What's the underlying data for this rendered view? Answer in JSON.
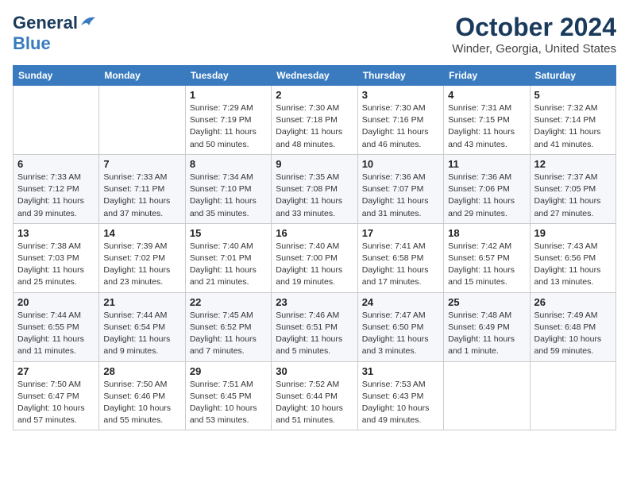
{
  "logo": {
    "line1": "General",
    "line2": "Blue"
  },
  "title": "October 2024",
  "subtitle": "Winder, Georgia, United States",
  "days_of_week": [
    "Sunday",
    "Monday",
    "Tuesday",
    "Wednesday",
    "Thursday",
    "Friday",
    "Saturday"
  ],
  "weeks": [
    [
      {
        "day": "",
        "info": ""
      },
      {
        "day": "",
        "info": ""
      },
      {
        "day": "1",
        "info": "Sunrise: 7:29 AM\nSunset: 7:19 PM\nDaylight: 11 hours and 50 minutes."
      },
      {
        "day": "2",
        "info": "Sunrise: 7:30 AM\nSunset: 7:18 PM\nDaylight: 11 hours and 48 minutes."
      },
      {
        "day": "3",
        "info": "Sunrise: 7:30 AM\nSunset: 7:16 PM\nDaylight: 11 hours and 46 minutes."
      },
      {
        "day": "4",
        "info": "Sunrise: 7:31 AM\nSunset: 7:15 PM\nDaylight: 11 hours and 43 minutes."
      },
      {
        "day": "5",
        "info": "Sunrise: 7:32 AM\nSunset: 7:14 PM\nDaylight: 11 hours and 41 minutes."
      }
    ],
    [
      {
        "day": "6",
        "info": "Sunrise: 7:33 AM\nSunset: 7:12 PM\nDaylight: 11 hours and 39 minutes."
      },
      {
        "day": "7",
        "info": "Sunrise: 7:33 AM\nSunset: 7:11 PM\nDaylight: 11 hours and 37 minutes."
      },
      {
        "day": "8",
        "info": "Sunrise: 7:34 AM\nSunset: 7:10 PM\nDaylight: 11 hours and 35 minutes."
      },
      {
        "day": "9",
        "info": "Sunrise: 7:35 AM\nSunset: 7:08 PM\nDaylight: 11 hours and 33 minutes."
      },
      {
        "day": "10",
        "info": "Sunrise: 7:36 AM\nSunset: 7:07 PM\nDaylight: 11 hours and 31 minutes."
      },
      {
        "day": "11",
        "info": "Sunrise: 7:36 AM\nSunset: 7:06 PM\nDaylight: 11 hours and 29 minutes."
      },
      {
        "day": "12",
        "info": "Sunrise: 7:37 AM\nSunset: 7:05 PM\nDaylight: 11 hours and 27 minutes."
      }
    ],
    [
      {
        "day": "13",
        "info": "Sunrise: 7:38 AM\nSunset: 7:03 PM\nDaylight: 11 hours and 25 minutes."
      },
      {
        "day": "14",
        "info": "Sunrise: 7:39 AM\nSunset: 7:02 PM\nDaylight: 11 hours and 23 minutes."
      },
      {
        "day": "15",
        "info": "Sunrise: 7:40 AM\nSunset: 7:01 PM\nDaylight: 11 hours and 21 minutes."
      },
      {
        "day": "16",
        "info": "Sunrise: 7:40 AM\nSunset: 7:00 PM\nDaylight: 11 hours and 19 minutes."
      },
      {
        "day": "17",
        "info": "Sunrise: 7:41 AM\nSunset: 6:58 PM\nDaylight: 11 hours and 17 minutes."
      },
      {
        "day": "18",
        "info": "Sunrise: 7:42 AM\nSunset: 6:57 PM\nDaylight: 11 hours and 15 minutes."
      },
      {
        "day": "19",
        "info": "Sunrise: 7:43 AM\nSunset: 6:56 PM\nDaylight: 11 hours and 13 minutes."
      }
    ],
    [
      {
        "day": "20",
        "info": "Sunrise: 7:44 AM\nSunset: 6:55 PM\nDaylight: 11 hours and 11 minutes."
      },
      {
        "day": "21",
        "info": "Sunrise: 7:44 AM\nSunset: 6:54 PM\nDaylight: 11 hours and 9 minutes."
      },
      {
        "day": "22",
        "info": "Sunrise: 7:45 AM\nSunset: 6:52 PM\nDaylight: 11 hours and 7 minutes."
      },
      {
        "day": "23",
        "info": "Sunrise: 7:46 AM\nSunset: 6:51 PM\nDaylight: 11 hours and 5 minutes."
      },
      {
        "day": "24",
        "info": "Sunrise: 7:47 AM\nSunset: 6:50 PM\nDaylight: 11 hours and 3 minutes."
      },
      {
        "day": "25",
        "info": "Sunrise: 7:48 AM\nSunset: 6:49 PM\nDaylight: 11 hours and 1 minute."
      },
      {
        "day": "26",
        "info": "Sunrise: 7:49 AM\nSunset: 6:48 PM\nDaylight: 10 hours and 59 minutes."
      }
    ],
    [
      {
        "day": "27",
        "info": "Sunrise: 7:50 AM\nSunset: 6:47 PM\nDaylight: 10 hours and 57 minutes."
      },
      {
        "day": "28",
        "info": "Sunrise: 7:50 AM\nSunset: 6:46 PM\nDaylight: 10 hours and 55 minutes."
      },
      {
        "day": "29",
        "info": "Sunrise: 7:51 AM\nSunset: 6:45 PM\nDaylight: 10 hours and 53 minutes."
      },
      {
        "day": "30",
        "info": "Sunrise: 7:52 AM\nSunset: 6:44 PM\nDaylight: 10 hours and 51 minutes."
      },
      {
        "day": "31",
        "info": "Sunrise: 7:53 AM\nSunset: 6:43 PM\nDaylight: 10 hours and 49 minutes."
      },
      {
        "day": "",
        "info": ""
      },
      {
        "day": "",
        "info": ""
      }
    ]
  ]
}
